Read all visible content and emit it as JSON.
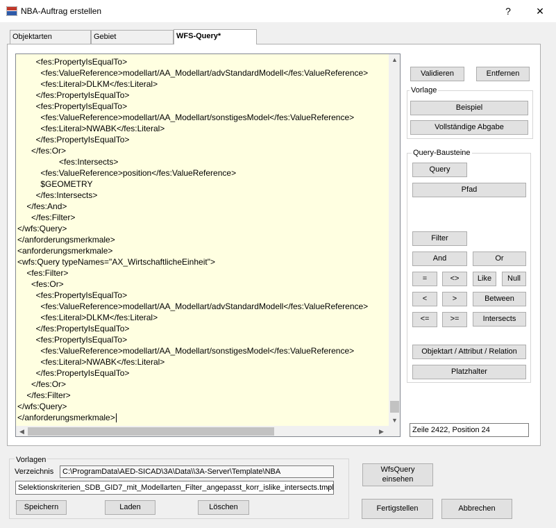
{
  "window": {
    "title": "NBA-Auftrag erstellen",
    "help_label": "?",
    "close_label": "✕"
  },
  "tabs": [
    {
      "label": "Objektarten"
    },
    {
      "label": "Gebiet"
    },
    {
      "label": "WFS-Query*"
    }
  ],
  "editor": {
    "lines": [
      "        <fes:PropertyIsEqualTo>",
      "          <fes:ValueReference>modellart/AA_Modellart/advStandardModell</fes:ValueReference>",
      "          <fes:Literal>DLKM</fes:Literal>",
      "        </fes:PropertyIsEqualTo>",
      "        <fes:PropertyIsEqualTo>",
      "          <fes:ValueReference>modellart/AA_Modellart/sonstigesModel</fes:ValueReference>",
      "          <fes:Literal>NWABK</fes:Literal>",
      "        </fes:PropertyIsEqualTo>",
      "      </fes:Or>",
      "                  <fes:Intersects>",
      "          <fes:ValueReference>position</fes:ValueReference>",
      "          $GEOMETRY",
      "        </fes:Intersects>",
      "    </fes:And>",
      "      </fes:Filter>",
      "</wfs:Query>",
      "</anforderungsmerkmale>",
      "<anforderungsmerkmale>",
      "<wfs:Query typeNames=\"AX_WirtschaftlicheEinheit\">",
      "    <fes:Filter>",
      "      <fes:Or>",
      "        <fes:PropertyIsEqualTo>",
      "          <fes:ValueReference>modellart/AA_Modellart/advStandardModell</fes:ValueReference>",
      "          <fes:Literal>DLKM</fes:Literal>",
      "        </fes:PropertyIsEqualTo>",
      "        <fes:PropertyIsEqualTo>",
      "          <fes:ValueReference>modellart/AA_Modellart/sonstigesModel</fes:ValueReference>",
      "          <fes:Literal>NWABK</fes:Literal>",
      "        </fes:PropertyIsEqualTo>",
      "      </fes:Or>",
      "    </fes:Filter>",
      "</wfs:Query>",
      "</anforderungsmerkmale>"
    ]
  },
  "right_panel": {
    "validieren": "Validieren",
    "entfernen": "Entfernen",
    "vorlage_label": "Vorlage",
    "beispiel": "Beispiel",
    "vollstaendige_abgabe": "Vollständige Abgabe",
    "bausteine_label": "Query-Bausteine",
    "query": "Query",
    "pfad": "Pfad",
    "filter": "Filter",
    "and": "And",
    "or": "Or",
    "eq": "=",
    "neq": "<>",
    "like": "Like",
    "null": "Null",
    "lt": "<",
    "gt": ">",
    "between": "Between",
    "le": "<=",
    "ge": ">=",
    "intersects": "Intersects",
    "objektart": "Objektart / Attribut / Relation",
    "platzhalter": "Platzhalter"
  },
  "status": "Zeile 2422, Position 24",
  "vorlagen": {
    "group_label": "Vorlagen",
    "verzeichnis_label": "Verzeichnis",
    "verzeichnis_value": "C:\\ProgramData\\AED-SICAD\\3A\\Data\\\\3A-Server\\Template\\NBA",
    "template_selected": "Selektionskriterien_SDB_GID7_mit_Modellarten_Filter_angepasst_korr_islike_intersects.tmpl",
    "speichern": "Speichern",
    "laden": "Laden",
    "loeschen": "Löschen"
  },
  "bottom": {
    "wfsquery_line1": "WfsQuery",
    "wfsquery_line2": "einsehen",
    "fertigstellen": "Fertigstellen",
    "abbrechen": "Abbrechen"
  },
  "colors": {
    "editor_bg": "#ffffe1",
    "button_bg": "#e1e1e1",
    "app_icon_red": "#c0392b",
    "app_icon_blue": "#2e5aa8"
  }
}
